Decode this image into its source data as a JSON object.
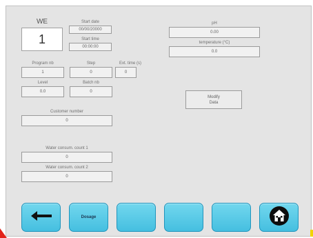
{
  "we": {
    "title": "WE",
    "value": "1"
  },
  "start_date": {
    "label": "Start date",
    "value": "00/00/20000"
  },
  "start_time": {
    "label": "Start time",
    "value": "00:00:00"
  },
  "program_nb": {
    "label": "Program nb",
    "value": "1"
  },
  "step": {
    "label": "Step",
    "value": "0"
  },
  "ext_time": {
    "label": "Ext. time (s)",
    "value": "0"
  },
  "level": {
    "label": "Level",
    "value": "0.0"
  },
  "batch_nb": {
    "label": "Batch nb",
    "value": "0"
  },
  "customer_number": {
    "label": "Customer number",
    "value": "0"
  },
  "water1": {
    "label": "Water consum. count 1",
    "value": "0"
  },
  "water2": {
    "label": "Water consum. count 2",
    "value": "0"
  },
  "ph": {
    "label": "pH",
    "value": "0.00"
  },
  "temperature": {
    "label": "temperature (°C)",
    "value": "0.0"
  },
  "modify": {
    "line1": "Modify",
    "line2": "Data"
  },
  "toolbar": {
    "back_icon": "left-arrow-icon",
    "dosage_label": "Dosage",
    "home_icon": "home-icon"
  },
  "colors": {
    "button_fill": "#45bfe0",
    "panel_bg": "#e4e4e4",
    "corner_red": "#e2231a",
    "corner_yellow": "#f2d400"
  }
}
